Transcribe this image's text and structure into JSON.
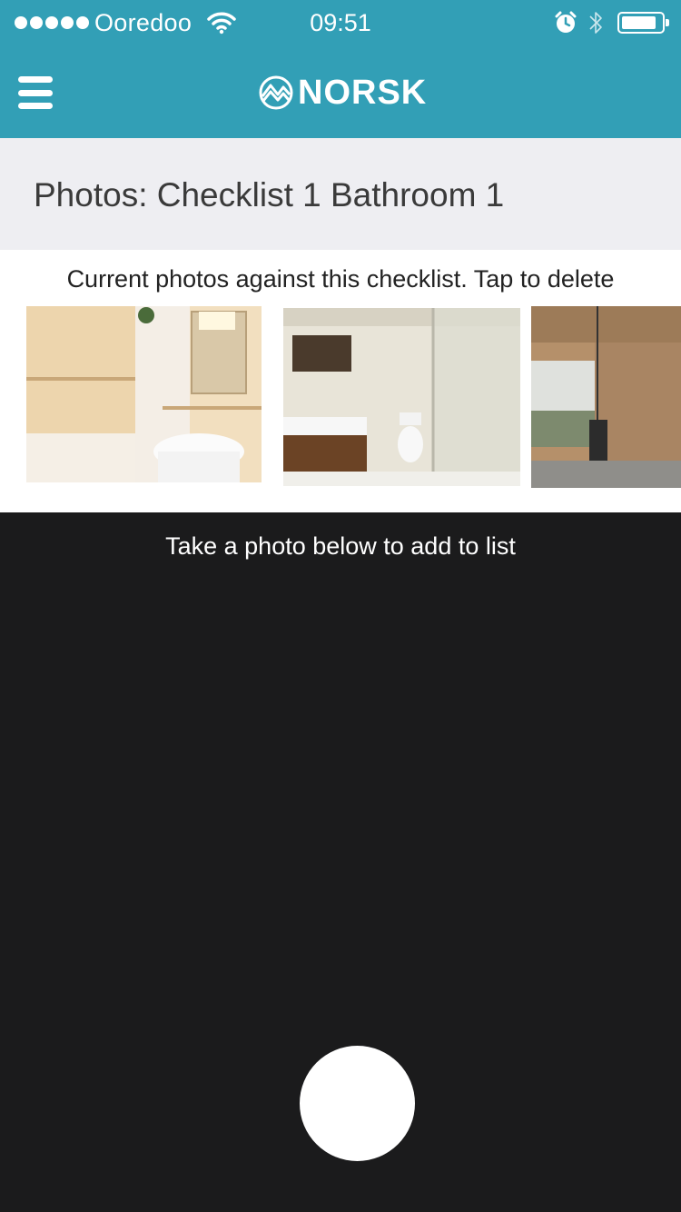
{
  "status_bar": {
    "carrier": "Ooredoo",
    "time": "09:51",
    "battery_level": 0.85
  },
  "header": {
    "logo_text": "NORSK",
    "menu_icon": "hamburger-menu-icon",
    "brand_color": "#329fb6"
  },
  "page": {
    "title": "Photos: Checklist 1 Bathroom 1"
  },
  "photos_section": {
    "caption": "Current photos against this checklist. Tap to delete",
    "photos": [
      {
        "subject": "bathroom-bathtub-sink"
      },
      {
        "subject": "bathroom-shower-toilet"
      },
      {
        "subject": "room-window-stove"
      }
    ]
  },
  "camera_section": {
    "caption": "Take a photo below to add to list",
    "background_color": "#1b1b1c"
  }
}
